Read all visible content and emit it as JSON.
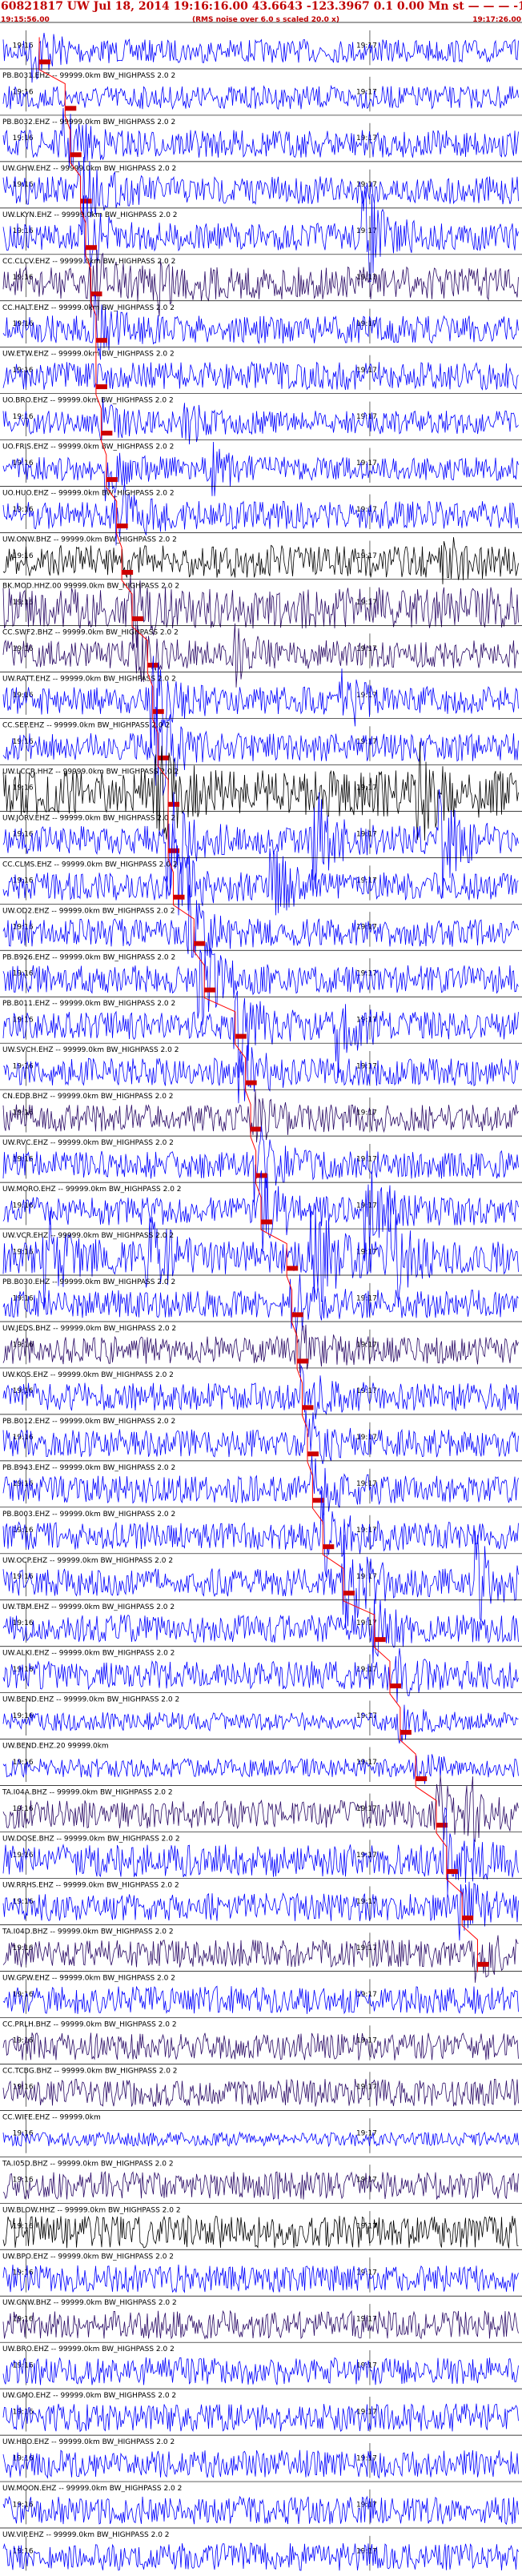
{
  "header": {
    "title": "60821817 UW Jul 18, 2014 19:16:16.00   43.6643 -123.3967  0.1 0.00 Mn st — — — -1",
    "start_time": "19:15:56.00",
    "note": "(RMS noise over 6.0 s scaled 20.0 x)",
    "end_time": "19:17:26.00"
  },
  "colors": {
    "blue": "#0000ff",
    "purple": "#2a0a66",
    "black": "#000000",
    "red": "#ff0000",
    "box": "#cc0000",
    "label": "#000000"
  },
  "chart_data": {
    "type": "seismogram-record",
    "event": {
      "id": "60821817",
      "network": "UW",
      "date": "Jul 18, 2014",
      "origin_time": "19:16:16.00",
      "lat": 43.6643,
      "lon": -123.3967
    },
    "time_range": [
      "19:15:56.00",
      "19:17:26.00"
    ],
    "tick_labels": [
      "19:16",
      "19:17"
    ],
    "traces": [
      {
        "label": "",
        "color": "blue",
        "bursts": [
          [
            0.06,
            2.2
          ]
        ],
        "pick": 0.07,
        "amp": 0.25
      },
      {
        "label": "PB.B031.EHZ -- 99999.0km BW_HIGHPASS  2.0  2",
        "color": "blue",
        "bursts": [],
        "pick": 0.12,
        "amp": 0.25
      },
      {
        "label": "PB.B032.EHZ -- 99999.0km BW_HIGHPASS  2.0  2",
        "color": "blue",
        "bursts": [
          [
            0.12,
            1.8
          ]
        ],
        "pick": 0.13,
        "amp": 0.3
      },
      {
        "label": "UW.GHW.EHZ -- 99999.0km BW_HIGHPASS  2.0  2",
        "color": "blue",
        "bursts": [
          [
            0.15,
            2.5
          ]
        ],
        "pick": 0.15,
        "amp": 0.3
      },
      {
        "label": "UW.LKYN.EHZ -- 99999.0km BW_HIGHPASS  2.0  2",
        "color": "blue",
        "bursts": [
          [
            0.16,
            2.0
          ],
          [
            0.7,
            3.5
          ]
        ],
        "pick": 0.16,
        "amp": 0.3
      },
      {
        "label": "CC.CLCV.EHZ -- 99999.0km BW_HIGHPASS  2.0  2",
        "color": "purple",
        "bursts": [
          [
            0.17,
            2.0
          ],
          [
            0.3,
            1.5
          ]
        ],
        "pick": 0.17,
        "amp": 0.35
      },
      {
        "label": "CC.HALT.EHZ -- 99999.0km BW_HIGHPASS  2.0  2",
        "color": "blue",
        "bursts": [
          [
            0.18,
            1.6
          ]
        ],
        "pick": 0.18,
        "amp": 0.3
      },
      {
        "label": "UW.ETW.EHZ -- 99999.0km BW_HIGHPASS  2.0  2",
        "color": "blue",
        "bursts": [],
        "pick": 0.18,
        "amp": 0.3
      },
      {
        "label": "UO.BRO.EHZ -- 99999.0km BW_HIGHPASS  2.0  2",
        "color": "blue",
        "bursts": [
          [
            0.19,
            1.3
          ],
          [
            0.35,
            1.8
          ]
        ],
        "pick": 0.19,
        "amp": 0.25
      },
      {
        "label": "UO.FRIS.EHZ -- 99999.0km BW_HIGHPASS  2.0  2",
        "color": "blue",
        "bursts": [
          [
            0.2,
            1.8
          ],
          [
            0.4,
            1.8
          ]
        ],
        "pick": 0.2,
        "amp": 0.25
      },
      {
        "label": "UO.HUO.EHZ -- 99999.0km BW_HIGHPASS  2.0  2",
        "color": "blue",
        "bursts": [
          [
            0.22,
            2.5
          ]
        ],
        "pick": 0.22,
        "amp": 0.3
      },
      {
        "label": "UW.ONW.BHZ -- 99999.0km BW_HIGHPASS  2.0  2",
        "color": "black",
        "bursts": [
          [
            0.85,
            1.4
          ]
        ],
        "pick": 0.23,
        "amp": 0.35
      },
      {
        "label": "BK.MOD.HHZ.00 99999.0km BW_HIGHPASS  2.0  2",
        "color": "purple",
        "bursts": [
          [
            0.25,
            1.3
          ]
        ],
        "pick": 0.25,
        "amp": 0.45
      },
      {
        "label": "CC.SWF2.BHZ -- 99999.0km BW_HIGHPASS  2.0  2",
        "color": "purple",
        "bursts": [
          [
            0.26,
            1.4
          ],
          [
            0.45,
            1.5
          ]
        ],
        "pick": 0.28,
        "amp": 0.3
      },
      {
        "label": "UW.RATT.EHZ -- 99999.0km BW_HIGHPASS  2.0  2",
        "color": "blue",
        "bursts": [
          [
            0.29,
            2.5
          ],
          [
            0.65,
            2.5
          ]
        ],
        "pick": 0.29,
        "amp": 0.3
      },
      {
        "label": "CC.SEP.EHZ -- 99999.0km BW_HIGHPASS  2.0  2",
        "color": "blue",
        "bursts": [
          [
            0.3,
            3.5
          ]
        ],
        "pick": 0.3,
        "amp": 0.3
      },
      {
        "label": "UW.LCCR.HHZ -- 99999.0km BW_HIGHPASS  2.0  2",
        "color": "black",
        "bursts": [
          [
            0.3,
            1.8
          ],
          [
            0.8,
            1.8
          ]
        ],
        "pick": 0.32,
        "amp": 0.5
      },
      {
        "label": "UW.JORV.EHZ -- 99999.0km BW_HIGHPASS  2.0  2",
        "color": "blue",
        "bursts": [
          [
            0.32,
            3.5
          ],
          [
            0.6,
            3.5
          ],
          [
            0.85,
            3.5
          ]
        ],
        "pick": 0.32,
        "amp": 0.3
      },
      {
        "label": "CC.CLMS.EHZ -- 99999.0km BW_HIGHPASS  2.0  2",
        "color": "blue",
        "bursts": [
          [
            0.33,
            3.5
          ],
          [
            0.52,
            2.5
          ]
        ],
        "pick": 0.33,
        "amp": 0.3
      },
      {
        "label": "UW.OD2.EHZ -- 99999.0km BW_HIGHPASS  2.0  2",
        "color": "blue",
        "bursts": [
          [
            0.36,
            3.0
          ]
        ],
        "pick": 0.37,
        "amp": 0.3
      },
      {
        "label": "PB.B926.EHZ -- 99999.0km BW_HIGHPASS  2.0  2",
        "color": "blue",
        "bursts": [
          [
            0.38,
            3.0
          ]
        ],
        "pick": 0.39,
        "amp": 0.3
      },
      {
        "label": "PB.B011.EHZ -- 99999.0km BW_HIGHPASS  2.0  2",
        "color": "blue",
        "bursts": [
          [
            0.45,
            3.5
          ],
          [
            0.65,
            3.0
          ]
        ],
        "pick": 0.45,
        "amp": 0.3
      },
      {
        "label": "UW.SVCH.EHZ -- 99999.0km BW_HIGHPASS  2.0  2",
        "color": "blue",
        "bursts": [
          [
            0.46,
            2.0
          ]
        ],
        "pick": 0.47,
        "amp": 0.3
      },
      {
        "label": "CN.EDB.BHZ -- 99999.0km BW_HIGHPASS  2.0  2",
        "color": "purple",
        "bursts": [
          [
            0.48,
            2.0
          ]
        ],
        "pick": 0.48,
        "amp": 0.3
      },
      {
        "label": "UW.RVC.EHZ -- 99999.0km BW_HIGHPASS  2.0  2",
        "color": "blue",
        "bursts": [
          [
            0.49,
            2.5
          ]
        ],
        "pick": 0.49,
        "amp": 0.3
      },
      {
        "label": "UW.MORO.EHZ -- 99999.0km BW_HIGHPASS  2.0  2",
        "color": "blue",
        "bursts": [
          [
            0.5,
            3.5
          ],
          [
            0.7,
            3.0
          ]
        ],
        "pick": 0.5,
        "amp": 0.3
      },
      {
        "label": "UW.VCR.EHZ -- 99999.0km BW_HIGHPASS  2.0  2",
        "color": "blue",
        "bursts": [
          [
            0.08,
            3.0
          ],
          [
            0.28,
            3.0
          ],
          [
            0.6,
            4.0
          ],
          [
            0.75,
            3.5
          ]
        ],
        "pick": 0.55,
        "amp": 0.35
      },
      {
        "label": "PB.B030.EHZ -- 99999.0km BW_HIGHPASS  2.0  2",
        "color": "blue",
        "bursts": [
          [
            0.56,
            1.8
          ]
        ],
        "pick": 0.56,
        "amp": 0.3
      },
      {
        "label": "UW.JEDS.BHZ -- 99999.0km BW_HIGHPASS  2.0  2",
        "color": "purple",
        "bursts": [
          [
            0.57,
            1.5
          ]
        ],
        "pick": 0.57,
        "amp": 0.3
      },
      {
        "label": "UW.KOS.EHZ -- 99999.0km BW_HIGHPASS  2.0  2",
        "color": "blue",
        "bursts": [
          [
            0.58,
            1.8
          ]
        ],
        "pick": 0.58,
        "amp": 0.3
      },
      {
        "label": "PB.B012.EHZ -- 99999.0km BW_HIGHPASS  2.0  2",
        "color": "blue",
        "bursts": [
          [
            0.59,
            1.8
          ]
        ],
        "pick": 0.59,
        "amp": 0.3
      },
      {
        "label": "PB.B943.EHZ -- 99999.0km BW_HIGHPASS  2.0  2",
        "color": "blue",
        "bursts": [
          [
            0.6,
            1.8
          ]
        ],
        "pick": 0.6,
        "amp": 0.3
      },
      {
        "label": "PB.B003.EHZ -- 99999.0km BW_HIGHPASS  2.0  2",
        "color": "blue",
        "bursts": [
          [
            0.62,
            2.5
          ]
        ],
        "pick": 0.62,
        "amp": 0.3
      },
      {
        "label": "UW.OCP.EHZ -- 99999.0km BW_HIGHPASS  2.0  2",
        "color": "blue",
        "bursts": [
          [
            0.66,
            4.5
          ],
          [
            0.92,
            3.0
          ]
        ],
        "pick": 0.66,
        "amp": 0.3
      },
      {
        "label": "UW.TBM.EHZ -- 99999.0km BW_HIGHPASS  2.0  2",
        "color": "blue",
        "bursts": [
          [
            0.72,
            1.6
          ]
        ],
        "pick": 0.72,
        "amp": 0.3
      },
      {
        "label": "UW.ALKI.EHZ -- 99999.0km BW_HIGHPASS  2.0  2",
        "color": "blue",
        "bursts": [
          [
            0.75,
            1.6
          ]
        ],
        "pick": 0.75,
        "amp": 0.3
      },
      {
        "label": "UW.BEND.EHZ -- 99999.0km BW_HIGHPASS  2.0  2",
        "color": "blue",
        "bursts": [
          [
            0.77,
            1.4
          ]
        ],
        "pick": 0.77,
        "amp": 0.2
      },
      {
        "label": "UW.BEND.EHZ.20 99999.0km",
        "color": "blue",
        "bursts": [
          [
            0.8,
            1.4
          ]
        ],
        "pick": 0.8,
        "amp": 0.2
      },
      {
        "label": "TA.I04A.BHZ -- 99999.0km BW_HIGHPASS  2.0  2",
        "color": "purple",
        "bursts": [
          [
            0.84,
            2.5
          ],
          [
            0.9,
            2.0
          ]
        ],
        "pick": 0.84,
        "amp": 0.3
      },
      {
        "label": "UW.DOSE.BHZ -- 99999.0km BW_HIGHPASS  2.0  2",
        "color": "blue",
        "bursts": [
          [
            0.85,
            3.0
          ]
        ],
        "pick": 0.86,
        "amp": 0.35
      },
      {
        "label": "UW.RRHS.EHZ -- 99999.0km BW_HIGHPASS  2.0  2",
        "color": "blue",
        "bursts": [
          [
            0.89,
            1.8
          ]
        ],
        "pick": 0.89,
        "amp": 0.3
      },
      {
        "label": "TA.I04D.BHZ -- 99999.0km BW_HIGHPASS  2.0  2",
        "color": "purple",
        "bursts": [
          [
            0.92,
            1.6
          ]
        ],
        "pick": 0.92,
        "amp": 0.3
      },
      {
        "label": "UW.GPW.EHZ -- 99999.0km BW_HIGHPASS  2.0  2",
        "color": "blue",
        "bursts": [],
        "pick": null,
        "amp": 0.3
      },
      {
        "label": "CC.PRLH.BHZ -- 99999.0km BW_HIGHPASS  2.0  2",
        "color": "purple",
        "bursts": [],
        "pick": null,
        "amp": 0.3
      },
      {
        "label": "CC.TCBG.BHZ -- 99999.0km BW_HIGHPASS  2.0  2",
        "color": "purple",
        "bursts": [],
        "pick": null,
        "amp": 0.3
      },
      {
        "label": "CC.WIFE.EHZ -- 99999.0km",
        "color": "blue",
        "bursts": [],
        "pick": null,
        "amp": 0.15
      },
      {
        "label": "TA.I05D.BHZ -- 99999.0km BW_HIGHPASS  2.0  2",
        "color": "purple",
        "bursts": [],
        "pick": null,
        "amp": 0.3
      },
      {
        "label": "UW.BLOW.HHZ -- 99999.0km BW_HIGHPASS  2.0  2",
        "color": "black",
        "bursts": [],
        "pick": null,
        "amp": 0.35
      },
      {
        "label": "UW.BPO.EHZ -- 99999.0km BW_HIGHPASS  2.0  2",
        "color": "blue",
        "bursts": [],
        "pick": null,
        "amp": 0.3
      },
      {
        "label": "UW.GNW.BHZ -- 99999.0km BW_HIGHPASS  2.0  2",
        "color": "purple",
        "bursts": [],
        "pick": null,
        "amp": 0.3
      },
      {
        "label": "UW.BRO.EHZ -- 99999.0km BW_HIGHPASS  2.0  2",
        "color": "blue",
        "bursts": [],
        "pick": null,
        "amp": 0.3
      },
      {
        "label": "UW.GMO.EHZ -- 99999.0km BW_HIGHPASS  2.0  2",
        "color": "blue",
        "bursts": [],
        "pick": null,
        "amp": 0.3
      },
      {
        "label": "UW.HBO.EHZ -- 99999.0km BW_HIGHPASS  2.0  2",
        "color": "blue",
        "bursts": [],
        "pick": null,
        "amp": 0.3
      },
      {
        "label": "UW.MOON.EHZ -- 99999.0km BW_HIGHPASS  2.0  2",
        "color": "blue",
        "bursts": [],
        "pick": null,
        "amp": 0.3
      },
      {
        "label": "UW.VIP.EHZ -- 99999.0km BW_HIGHPASS  2.0  2",
        "color": "blue",
        "bursts": [],
        "pick": null,
        "amp": 0.3
      }
    ]
  }
}
